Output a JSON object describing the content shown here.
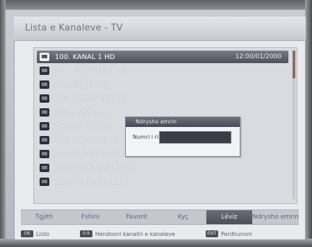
{
  "window": {
    "title": "Lista e Kanaleve - TV"
  },
  "channels": [
    {
      "label": "100. KANAL 1 HD",
      "selected": true,
      "time": "12:00/01/2000"
    },
    {
      "label": "101. EUROSPORT HD"
    },
    {
      "label": "102. SMART 10"
    },
    {
      "label": "103. DISCOVERY HD"
    },
    {
      "label": "104. ANIMAL PL"
    },
    {
      "label": "105. DST SMART"
    },
    {
      "label": "106. SINGPLUS HD"
    },
    {
      "label": "107. SINEGOLD HD"
    },
    {
      "label": "108. SMART SPOR 2 HD"
    },
    {
      "label": "109. PORTADIUSE HD"
    }
  ],
  "popup": {
    "title": "Ndrysho emrin",
    "field_label": "Numri i ri:",
    "field_value": ""
  },
  "tabs": [
    {
      "label": "Tgjith",
      "active": false
    },
    {
      "label": "Fshini",
      "active": false
    },
    {
      "label": "Favorit",
      "active": false
    },
    {
      "label": "Kyç",
      "active": false
    },
    {
      "label": "Lëviz",
      "active": true
    },
    {
      "label": "Ndrysho emrin",
      "active": false
    }
  ],
  "help": [
    {
      "key": "OK",
      "label": "Listo"
    },
    {
      "key": "0-9",
      "label": "Hendosni kanalin e kanaleve"
    },
    {
      "key": "EXIT",
      "label": "Perdhunoni"
    }
  ],
  "colors": {
    "selected_row": "#5b5f6a",
    "active_tab": "#5a5e69",
    "scroll_thumb": "#8f6b5a"
  }
}
